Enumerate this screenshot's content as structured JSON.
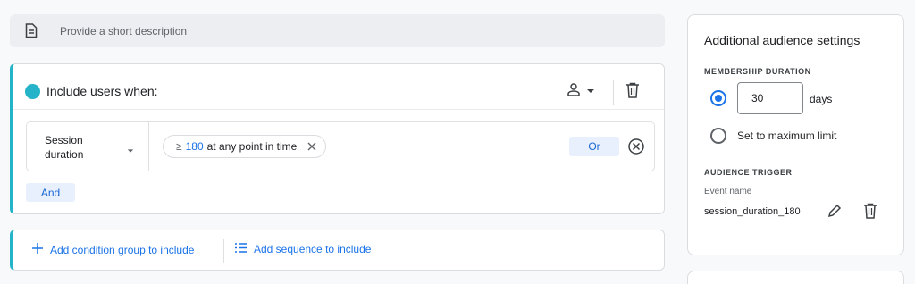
{
  "description": {
    "placeholder": "Provide a short description"
  },
  "condition_group": {
    "title": "Include users when:",
    "condition": {
      "dimension_line1": "Session",
      "dimension_line2": "duration",
      "operator": "≥",
      "value": "180",
      "scope": "at any point in time",
      "or_label": "Or"
    },
    "and_label": "And"
  },
  "add_actions": {
    "add_group_label": "Add condition group to include",
    "add_sequence_label": "Add sequence to include"
  },
  "settings": {
    "title": "Additional audience settings",
    "membership_duration_label": "MEMBERSHIP DURATION",
    "duration_value": "30",
    "duration_unit": "days",
    "max_limit_label": "Set to maximum limit",
    "selected_option": "custom_days",
    "trigger_label": "AUDIENCE TRIGGER",
    "event_name_label": "Event name",
    "event_name_value": "session_duration_180"
  },
  "colors": {
    "accent": "#24b3c9",
    "link": "#1a73e8",
    "chip_bg": "#e8f0fe"
  },
  "icons": [
    "document-icon",
    "person-icon",
    "trash-icon",
    "caret-down-icon",
    "close-icon",
    "circle-close-icon",
    "plus-icon",
    "list-icon",
    "pencil-icon"
  ]
}
